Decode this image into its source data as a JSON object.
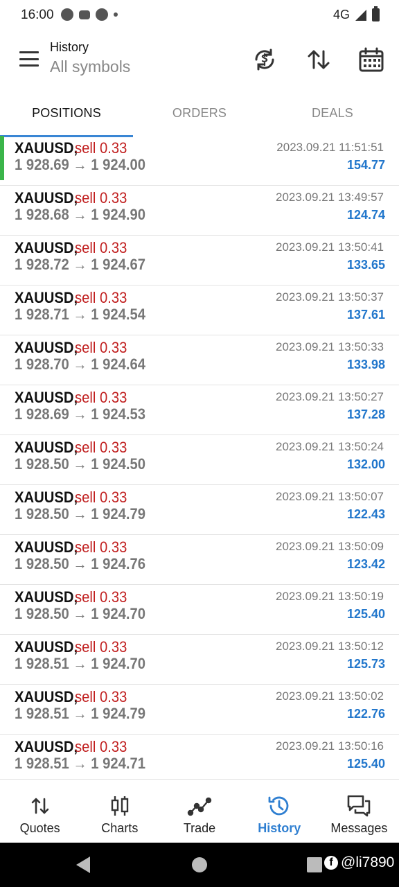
{
  "status_bar": {
    "time": "16:00",
    "network": "4G",
    "icons": [
      "telegram-icon",
      "chat-icon",
      "navigation-icon",
      "dot-icon",
      "signal-icon",
      "battery-icon"
    ]
  },
  "app_bar": {
    "title": "History",
    "subtitle": "All symbols",
    "actions": [
      "currency-exchange-icon",
      "sort-icon",
      "calendar-icon"
    ]
  },
  "tabs": [
    {
      "label": "POSITIONS",
      "active": true
    },
    {
      "label": "ORDERS",
      "active": false
    },
    {
      "label": "DEALS",
      "active": false
    }
  ],
  "positions": [
    {
      "symbol": "XAUUSD,",
      "side": "sell 0.33",
      "prices": "1 928.69 → 1 924.00",
      "time": "2023.09.21 11:51:51",
      "profit": "154.77"
    },
    {
      "symbol": "XAUUSD,",
      "side": "sell 0.33",
      "prices": "1 928.68 → 1 924.90",
      "time": "2023.09.21 13:49:57",
      "profit": "124.74"
    },
    {
      "symbol": "XAUUSD,",
      "side": "sell 0.33",
      "prices": "1 928.72 → 1 924.67",
      "time": "2023.09.21 13:50:41",
      "profit": "133.65"
    },
    {
      "symbol": "XAUUSD,",
      "side": "sell 0.33",
      "prices": "1 928.71 → 1 924.54",
      "time": "2023.09.21 13:50:37",
      "profit": "137.61"
    },
    {
      "symbol": "XAUUSD,",
      "side": "sell 0.33",
      "prices": "1 928.70 → 1 924.64",
      "time": "2023.09.21 13:50:33",
      "profit": "133.98"
    },
    {
      "symbol": "XAUUSD,",
      "side": "sell 0.33",
      "prices": "1 928.69 → 1 924.53",
      "time": "2023.09.21 13:50:27",
      "profit": "137.28"
    },
    {
      "symbol": "XAUUSD,",
      "side": "sell 0.33",
      "prices": "1 928.50 → 1 924.50",
      "time": "2023.09.21 13:50:24",
      "profit": "132.00"
    },
    {
      "symbol": "XAUUSD,",
      "side": "sell 0.33",
      "prices": "1 928.50 → 1 924.79",
      "time": "2023.09.21 13:50:07",
      "profit": "122.43"
    },
    {
      "symbol": "XAUUSD,",
      "side": "sell 0.33",
      "prices": "1 928.50 → 1 924.76",
      "time": "2023.09.21 13:50:09",
      "profit": "123.42"
    },
    {
      "symbol": "XAUUSD,",
      "side": "sell 0.33",
      "prices": "1 928.50 → 1 924.70",
      "time": "2023.09.21 13:50:19",
      "profit": "125.40"
    },
    {
      "symbol": "XAUUSD,",
      "side": "sell 0.33",
      "prices": "1 928.51 → 1 924.70",
      "time": "2023.09.21 13:50:12",
      "profit": "125.73"
    },
    {
      "symbol": "XAUUSD,",
      "side": "sell 0.33",
      "prices": "1 928.51 → 1 924.79",
      "time": "2023.09.21 13:50:02",
      "profit": "122.76"
    },
    {
      "symbol": "XAUUSD,",
      "side": "sell 0.33",
      "prices": "1 928.51 → 1 924.71",
      "time": "2023.09.21 13:50:16",
      "profit": "125.40"
    }
  ],
  "bottom_nav": [
    {
      "label": "Quotes",
      "icon": "quotes-icon",
      "active": false
    },
    {
      "label": "Charts",
      "icon": "charts-icon",
      "active": false
    },
    {
      "label": "Trade",
      "icon": "trade-icon",
      "active": false
    },
    {
      "label": "History",
      "icon": "history-icon",
      "active": true
    },
    {
      "label": "Messages",
      "icon": "messages-icon",
      "active": false
    }
  ],
  "watermark": "@li7890",
  "colors": {
    "sell": "#c11f1f",
    "profit": "#2277cc",
    "accent": "#2f7fd1",
    "selected_marker": "#3bb54a"
  }
}
